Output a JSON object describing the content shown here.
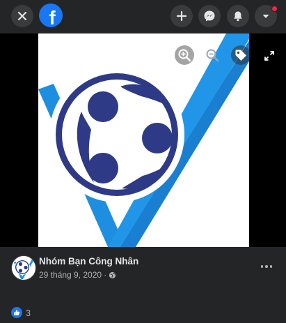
{
  "topbar": {
    "logo_letter": "f",
    "icons": [
      "close-icon",
      "facebook-logo",
      "plus-icon",
      "messenger-icon",
      "bell-icon",
      "chevron-down-icon"
    ],
    "notification_dot_color": "#f02849"
  },
  "viewer": {
    "tools": [
      "zoom-in-icon",
      "zoom-out-icon",
      "tag-icon",
      "expand-icon"
    ]
  },
  "post": {
    "group_name": "Nhóm Bạn Công Nhân",
    "date": "29 tháng 9, 2020",
    "separator": "·",
    "privacy_icon": "globe-icon"
  },
  "reactions": {
    "count": "3",
    "icon": "like-icon"
  },
  "colors": {
    "background": "#242526",
    "button": "#3a3b3c",
    "facebook_blue": "#1877f2",
    "logo_navy": "#2e3a86",
    "logo_blue": "#1e8fe0"
  }
}
